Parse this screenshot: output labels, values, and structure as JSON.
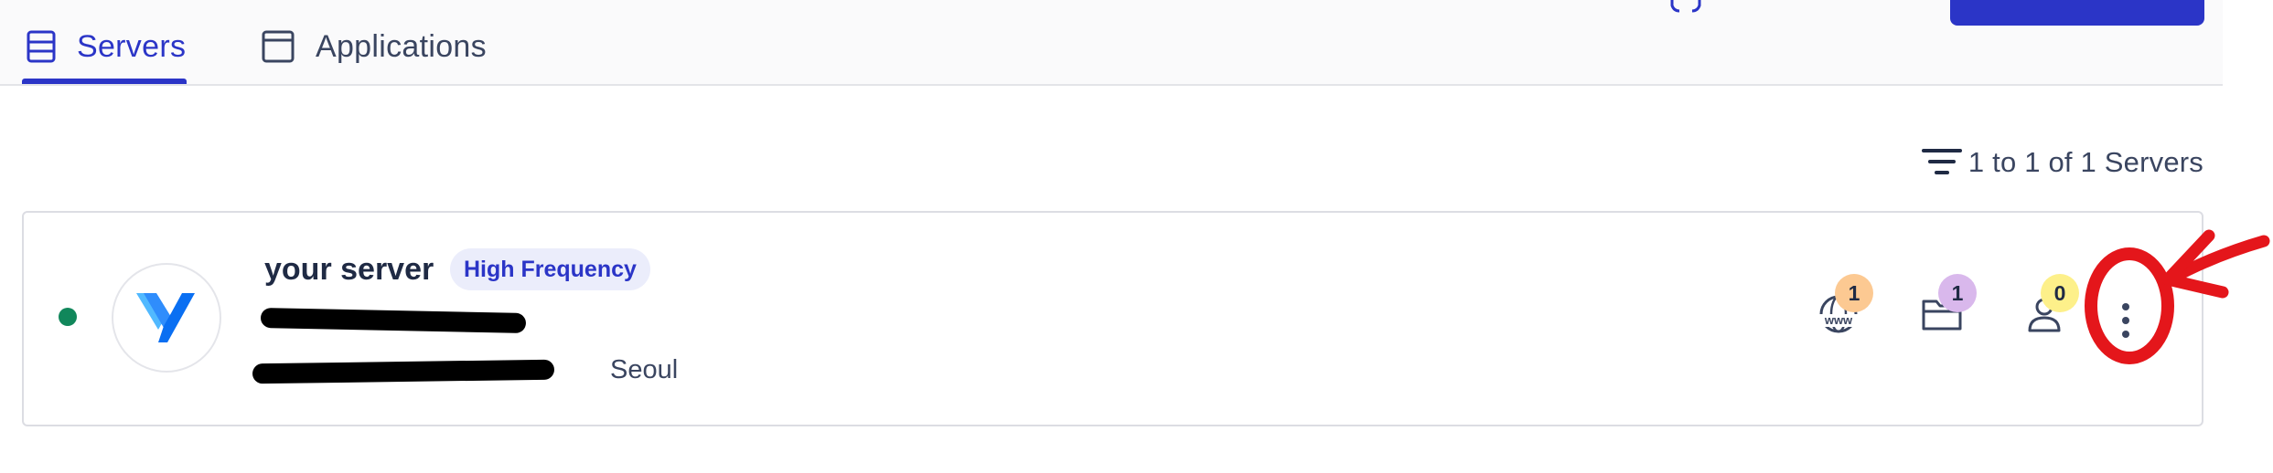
{
  "tabs": [
    {
      "label": "Servers",
      "active": true,
      "icon": "server-icon"
    },
    {
      "label": "Applications",
      "active": false,
      "icon": "window-icon"
    }
  ],
  "toolbar": {
    "filter_icon": "filter-icon",
    "count_text": "1 to 1 of 1 Servers"
  },
  "server": {
    "name": "your server",
    "badge": "High Frequency",
    "status": "running",
    "status_color": "#11875b",
    "provider_logo": "vultr-logo",
    "location": "Seoul",
    "stats": [
      {
        "icon": "www-globe-icon",
        "count": "1",
        "badge_color": "#fcc992"
      },
      {
        "icon": "folder-icon",
        "count": "1",
        "badge_color": "#d9b8ec"
      },
      {
        "icon": "user-icon",
        "count": "0",
        "badge_color": "#fdf08a"
      }
    ],
    "menu_icon": "more-vertical-icon"
  },
  "colors": {
    "accent": "#2b35c7",
    "text": "#1f2a44",
    "annotation": "#e4161b"
  }
}
